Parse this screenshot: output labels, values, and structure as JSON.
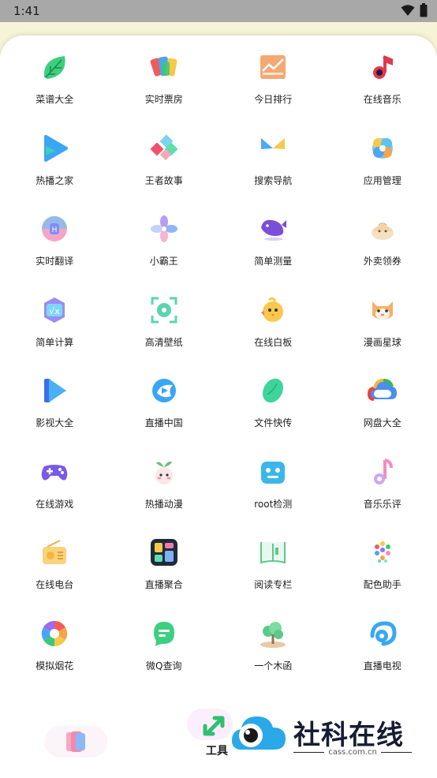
{
  "status_bar": {
    "time": "1:41"
  },
  "apps": [
    {
      "label": "菜谱大全",
      "icon": "leaf-icon"
    },
    {
      "label": "实时票房",
      "icon": "cards-icon"
    },
    {
      "label": "今日排行",
      "icon": "trend-chart-icon"
    },
    {
      "label": "在线音乐",
      "icon": "music-note-icon"
    },
    {
      "label": "热播之家",
      "icon": "play-icon"
    },
    {
      "label": "王者故事",
      "icon": "diamonds-icon"
    },
    {
      "label": "搜索导航",
      "icon": "butterfly-icon"
    },
    {
      "label": "应用管理",
      "icon": "gear-flower-icon"
    },
    {
      "label": "实时翻译",
      "icon": "translate-icon"
    },
    {
      "label": "小霸王",
      "icon": "pinwheel-icon"
    },
    {
      "label": "简单测量",
      "icon": "whale-icon"
    },
    {
      "label": "外卖领券",
      "icon": "dumpling-icon"
    },
    {
      "label": "简单计算",
      "icon": "sqrt-calc-icon"
    },
    {
      "label": "高清壁纸",
      "icon": "frame-flower-icon"
    },
    {
      "label": "在线白板",
      "icon": "chick-icon"
    },
    {
      "label": "漫画星球",
      "icon": "cat-icon"
    },
    {
      "label": "影视大全",
      "icon": "video-play-icon"
    },
    {
      "label": "直播中国",
      "icon": "bird-play-icon"
    },
    {
      "label": "文件快传",
      "icon": "bean-icon"
    },
    {
      "label": "网盘大全",
      "icon": "cloud-icon"
    },
    {
      "label": "在线游戏",
      "icon": "gamepad-icon"
    },
    {
      "label": "热播动漫",
      "icon": "sprout-character-icon"
    },
    {
      "label": "root检测",
      "icon": "robot-icon"
    },
    {
      "label": "音乐乐评",
      "icon": "music-note-pink-icon"
    },
    {
      "label": "在线电台",
      "icon": "radio-icon"
    },
    {
      "label": "直播聚合",
      "icon": "blocks-icon"
    },
    {
      "label": "阅读专栏",
      "icon": "book-icon"
    },
    {
      "label": "配色助手",
      "icon": "palette-dots-icon"
    },
    {
      "label": "模拟烟花",
      "icon": "aperture-icon"
    },
    {
      "label": "微Q查询",
      "icon": "chat-bubble-icon"
    },
    {
      "label": "一个木函",
      "icon": "tree-icon"
    },
    {
      "label": "直播电视",
      "icon": "swirl-icon"
    }
  ],
  "bottom_nav": {
    "tools_label": "工具"
  },
  "watermark": {
    "title": "社科在线",
    "url": "cass.com.cn"
  }
}
